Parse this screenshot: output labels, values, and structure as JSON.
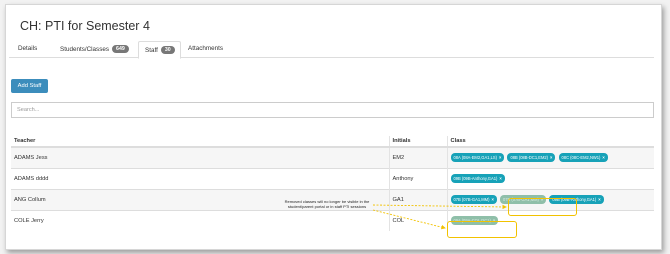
{
  "page": {
    "title": "CH: PTI for Semester 4"
  },
  "tabs": [
    {
      "label": "Details",
      "badge": null
    },
    {
      "label": "Students/Classes",
      "badge": "649"
    },
    {
      "label": "Staff",
      "badge": "30"
    },
    {
      "label": "Attachments",
      "badge": null
    }
  ],
  "toolbar": {
    "add_label": "Add Staff"
  },
  "search": {
    "placeholder": "Search...",
    "value": ""
  },
  "table": {
    "headers": [
      "Teacher",
      "Initials",
      "Class"
    ],
    "rows": [
      {
        "teacher": "ADAMS Jess",
        "initials": "EM2",
        "classes": [
          "08A (08A-EM2,GA1,LS)",
          "08B (08B-DC1,EM2)",
          "08C (08C-EM2,NW1)"
        ],
        "removed": []
      },
      {
        "teacher": "ADAMS dddd",
        "initials": "Anthony",
        "classes": [
          "09B (09B-Anthony,GA1)"
        ],
        "removed": []
      },
      {
        "teacher": "ANG Collum",
        "initials": "GA1",
        "classes": [
          "07B (07B-GA1,MM)"
        ],
        "removed": [
          "07B (07B-GA1,MM)"
        ],
        "after_removed": [
          "09B (09B-Anthony,GA1)"
        ]
      },
      {
        "teacher": "COLE Jerry",
        "initials": "COL",
        "classes": [],
        "removed": [
          "09A (09A-COL,DC1)"
        ]
      }
    ]
  },
  "annotation": {
    "text": "Removed classes will no longer be visible in the student/parent portal or in staff PTI sessions",
    "color": "#f2c200"
  },
  "colors": {
    "accent": "#3c8dbc",
    "pill": "#17a2b8",
    "pill_removed": "#8fbfa9",
    "highlight": "#f2c200"
  }
}
